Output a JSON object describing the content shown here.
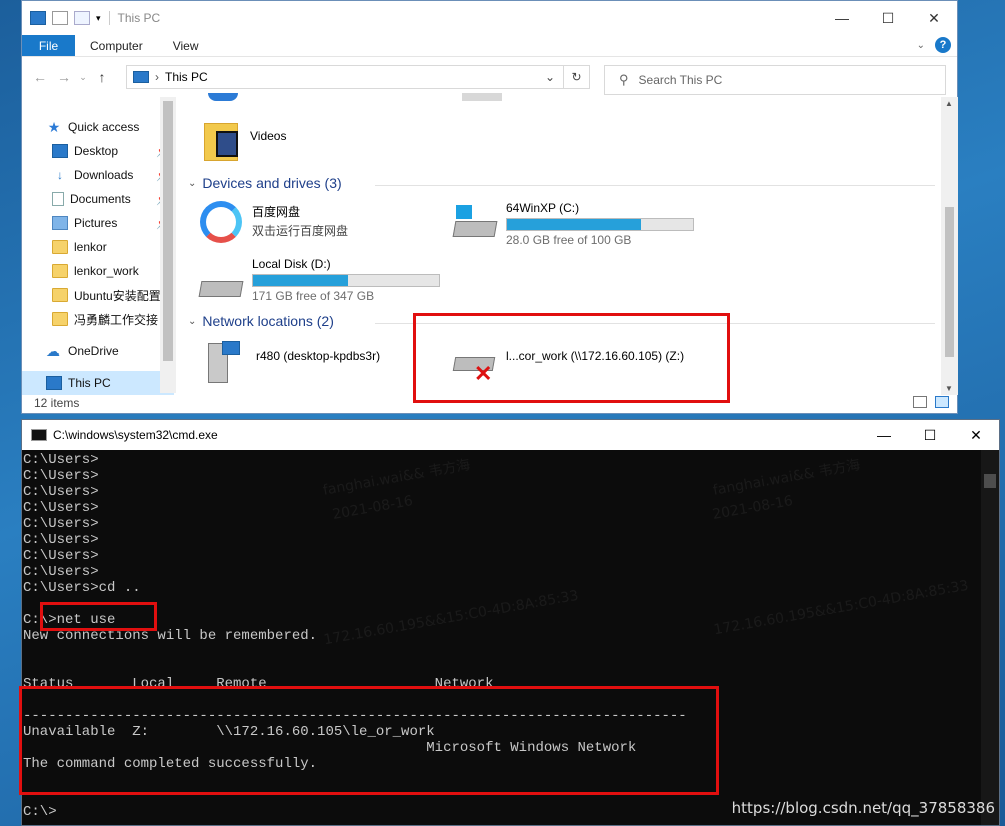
{
  "explorer": {
    "title": "This PC",
    "ribbon_tabs": [
      "File",
      "Computer",
      "View"
    ],
    "address": "This PC",
    "search_placeholder": "Search This PC",
    "nav": {
      "quick_access": "Quick access",
      "items": [
        {
          "label": "Desktop",
          "pinned": true
        },
        {
          "label": "Downloads",
          "pinned": true
        },
        {
          "label": "Documents",
          "pinned": true
        },
        {
          "label": "Pictures",
          "pinned": true
        },
        {
          "label": "lenkor",
          "pinned": false
        },
        {
          "label": "lenkor_work",
          "pinned": false
        },
        {
          "label": "Ubuntu安装配置",
          "pinned": false
        },
        {
          "label": "冯勇麟工作交接",
          "pinned": false
        }
      ],
      "onedrive": "OneDrive",
      "this_pc": "This PC"
    },
    "folders": {
      "videos": "Videos"
    },
    "devices_header": "Devices and drives (3)",
    "drives": [
      {
        "name": "百度网盘",
        "sub": "双击运行百度网盘"
      },
      {
        "name": "64WinXP  (C:)",
        "free": "28.0 GB free of 100 GB",
        "used_fraction": 0.72
      },
      {
        "name": "Local Disk (D:)",
        "free": "171 GB free of 347 GB",
        "used_fraction": 0.51
      }
    ],
    "network_header": "Network locations (2)",
    "network": [
      {
        "name": "r480 (desktop-kpdbs3r)"
      },
      {
        "name": "l...cor_work (\\\\172.16.60.105) (Z:)"
      }
    ],
    "status": "12 items"
  },
  "cmd": {
    "title": "C:\\windows\\system32\\cmd.exe",
    "lines": [
      "C:\\Users>",
      "C:\\Users>",
      "C:\\Users>",
      "C:\\Users>",
      "C:\\Users>",
      "C:\\Users>",
      "C:\\Users>",
      "C:\\Users>",
      "C:\\Users>cd ..",
      "",
      "C:\\>net use",
      "New connections will be remembered.",
      "",
      "",
      "Status       Local     Remote                    Network",
      "",
      "-------------------------------------------------------------------------------",
      "Unavailable  Z:        \\\\172.16.60.105\\le_or_work",
      "                                                Microsoft Windows Network",
      "The command completed successfully.",
      "",
      "",
      "C:\\>"
    ],
    "watermarks": [
      "fanghai.wai&& 韦方海",
      "2021-08-16",
      "172.16.60.195&&15:C0-4D:8A:85:33",
      "fanghai.wai&& 韦方海",
      "2021-08-16",
      "172.16.60.195&&15:C0-4D:8A:85:33"
    ],
    "url": "https://blog.csdn.net/qq_37858386"
  }
}
